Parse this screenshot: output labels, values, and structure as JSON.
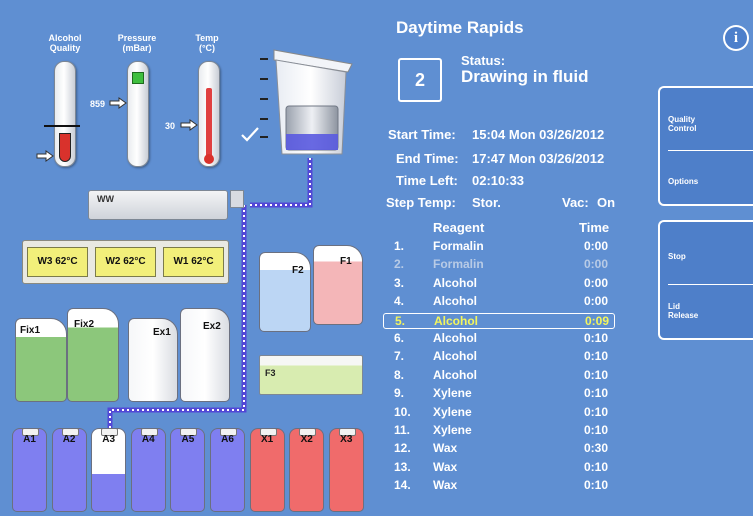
{
  "gauges": {
    "alcohol_quality": {
      "label": "Alcohol\nQuality",
      "level": 0.3
    },
    "pressure": {
      "label": "Pressure\n(mBar)",
      "reading": "859",
      "level": 0.8
    },
    "temp": {
      "label": "Temp\n(°C)",
      "reading": "30",
      "level": 0.75
    }
  },
  "instrument": {
    "ww_label": "WW",
    "wax_baths": [
      "W3 62°C",
      "W2 62°C",
      "W1 62°C"
    ],
    "fix_containers": [
      "Fix1",
      "Fix2"
    ],
    "ethanol_containers": [
      "Ex1",
      "Ex2"
    ],
    "f_containers": [
      "F2",
      "F1"
    ],
    "f3_label": "F3",
    "bottles": [
      {
        "name": "A1",
        "color": "#7f7ff0",
        "fill": 1.0
      },
      {
        "name": "A2",
        "color": "#7f7ff0",
        "fill": 1.0
      },
      {
        "name": "A3",
        "color": "#7f7ff0",
        "fill": 0.45
      },
      {
        "name": "A4",
        "color": "#7f7ff0",
        "fill": 1.0
      },
      {
        "name": "A5",
        "color": "#7f7ff0",
        "fill": 1.0
      },
      {
        "name": "A6",
        "color": "#7f7ff0",
        "fill": 1.0
      },
      {
        "name": "X1",
        "color": "#f06b6b",
        "fill": 1.0
      },
      {
        "name": "X2",
        "color": "#f06b6b",
        "fill": 1.0
      },
      {
        "name": "X3",
        "color": "#f06b6b",
        "fill": 1.0
      }
    ]
  },
  "protocol": {
    "name": "Daytime Rapids",
    "status_label": "Status:",
    "status_value": "Drawing in fluid",
    "step_number": "2",
    "start_label": "Start Time:",
    "start_value": "15:04  Mon 03/26/2012",
    "end_label": "End Time:",
    "end_value": "17:47  Mon 03/26/2012",
    "left_label": "Time Left:",
    "left_value": "02:10:33",
    "steptemp_label": "Step Temp:",
    "steptemp_value": "Stor.",
    "vac_label": "Vac:",
    "vac_value": "On",
    "col_reagent": "Reagent",
    "col_time": "Time",
    "steps": [
      {
        "n": "1.",
        "reagent": "Formalin",
        "time": "0:00",
        "state": "normal"
      },
      {
        "n": "2.",
        "reagent": "Formalin",
        "time": "0:00",
        "state": "dim"
      },
      {
        "n": "3.",
        "reagent": "Alcohol",
        "time": "0:00",
        "state": "normal"
      },
      {
        "n": "4.",
        "reagent": "Alcohol",
        "time": "0:00",
        "state": "normal"
      },
      {
        "n": "5.",
        "reagent": "Alcohol",
        "time": "0:09",
        "state": "current"
      },
      {
        "n": "6.",
        "reagent": "Alcohol",
        "time": "0:10",
        "state": "normal"
      },
      {
        "n": "7.",
        "reagent": "Alcohol",
        "time": "0:10",
        "state": "normal"
      },
      {
        "n": "8.",
        "reagent": "Alcohol",
        "time": "0:10",
        "state": "normal"
      },
      {
        "n": "9.",
        "reagent": "Xylene",
        "time": "0:10",
        "state": "normal"
      },
      {
        "n": "10.",
        "reagent": "Xylene",
        "time": "0:10",
        "state": "normal"
      },
      {
        "n": "11.",
        "reagent": "Xylene",
        "time": "0:10",
        "state": "normal"
      },
      {
        "n": "12.",
        "reagent": "Wax",
        "time": "0:30",
        "state": "normal"
      },
      {
        "n": "13.",
        "reagent": "Wax",
        "time": "0:10",
        "state": "normal"
      },
      {
        "n": "14.",
        "reagent": "Wax",
        "time": "0:10",
        "state": "normal"
      }
    ]
  },
  "side": {
    "quality_control": "Quality\nControl",
    "options": "Options",
    "stop": "Stop",
    "lid_release": "Lid\nRelease",
    "info_icon": "i"
  },
  "icons": {
    "checkmark": "check-icon",
    "arrow": "arrow-right-icon",
    "info": "info-icon"
  }
}
